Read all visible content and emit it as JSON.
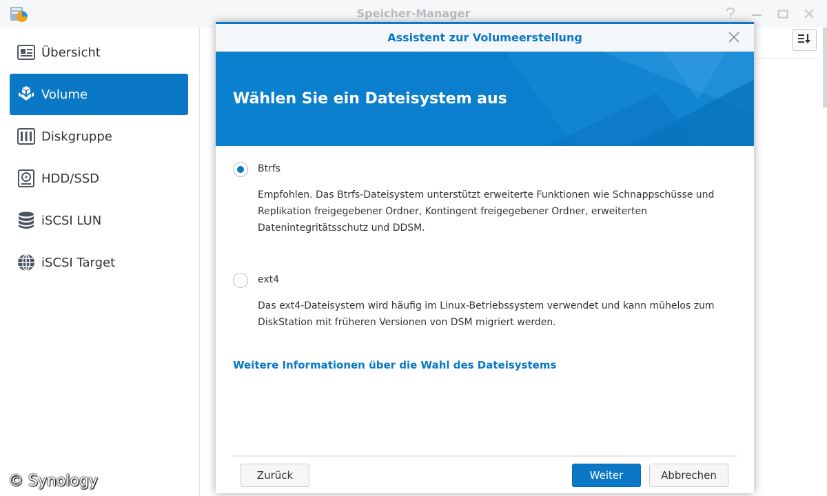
{
  "window": {
    "title": "Speicher-Manager"
  },
  "sidebar": {
    "items": [
      {
        "label": "Übersicht",
        "icon": "overview-icon"
      },
      {
        "label": "Volume",
        "icon": "volume-icon"
      },
      {
        "label": "Diskgruppe",
        "icon": "diskgroup-icon"
      },
      {
        "label": "HDD/SSD",
        "icon": "hdd-icon"
      },
      {
        "label": "iSCSI LUN",
        "icon": "database-icon"
      },
      {
        "label": "iSCSI Target",
        "icon": "globe-icon"
      }
    ],
    "active_index": 1
  },
  "watermark": "© Synology",
  "dialog": {
    "title": "Assistent zur Volumeerstellung",
    "banner_title": "Wählen Sie ein Dateisystem aus",
    "options": [
      {
        "label": "Btrfs",
        "checked": true,
        "description": "Empfohlen. Das Btrfs-Dateisystem unterstützt erweiterte Funktionen wie Schnappschüsse und Replikation freigegebener Ordner, Kontingent freigegebener Ordner, erweiterten Datenintegritätsschutz und DDSM."
      },
      {
        "label": "ext4",
        "checked": false,
        "description": "Das ext4-Dateisystem wird häufig im Linux-Betriebssystem verwendet und kann mühelos zum DiskStation mit früheren Versionen von DSM migriert werden."
      }
    ],
    "info_link": "Weitere Informationen über die Wahl des Dateisystems",
    "buttons": {
      "back": "Zurück",
      "next": "Weiter",
      "cancel": "Abbrechen"
    }
  },
  "colors": {
    "accent": "#0a78c4",
    "banner": "#0b7fcd"
  }
}
